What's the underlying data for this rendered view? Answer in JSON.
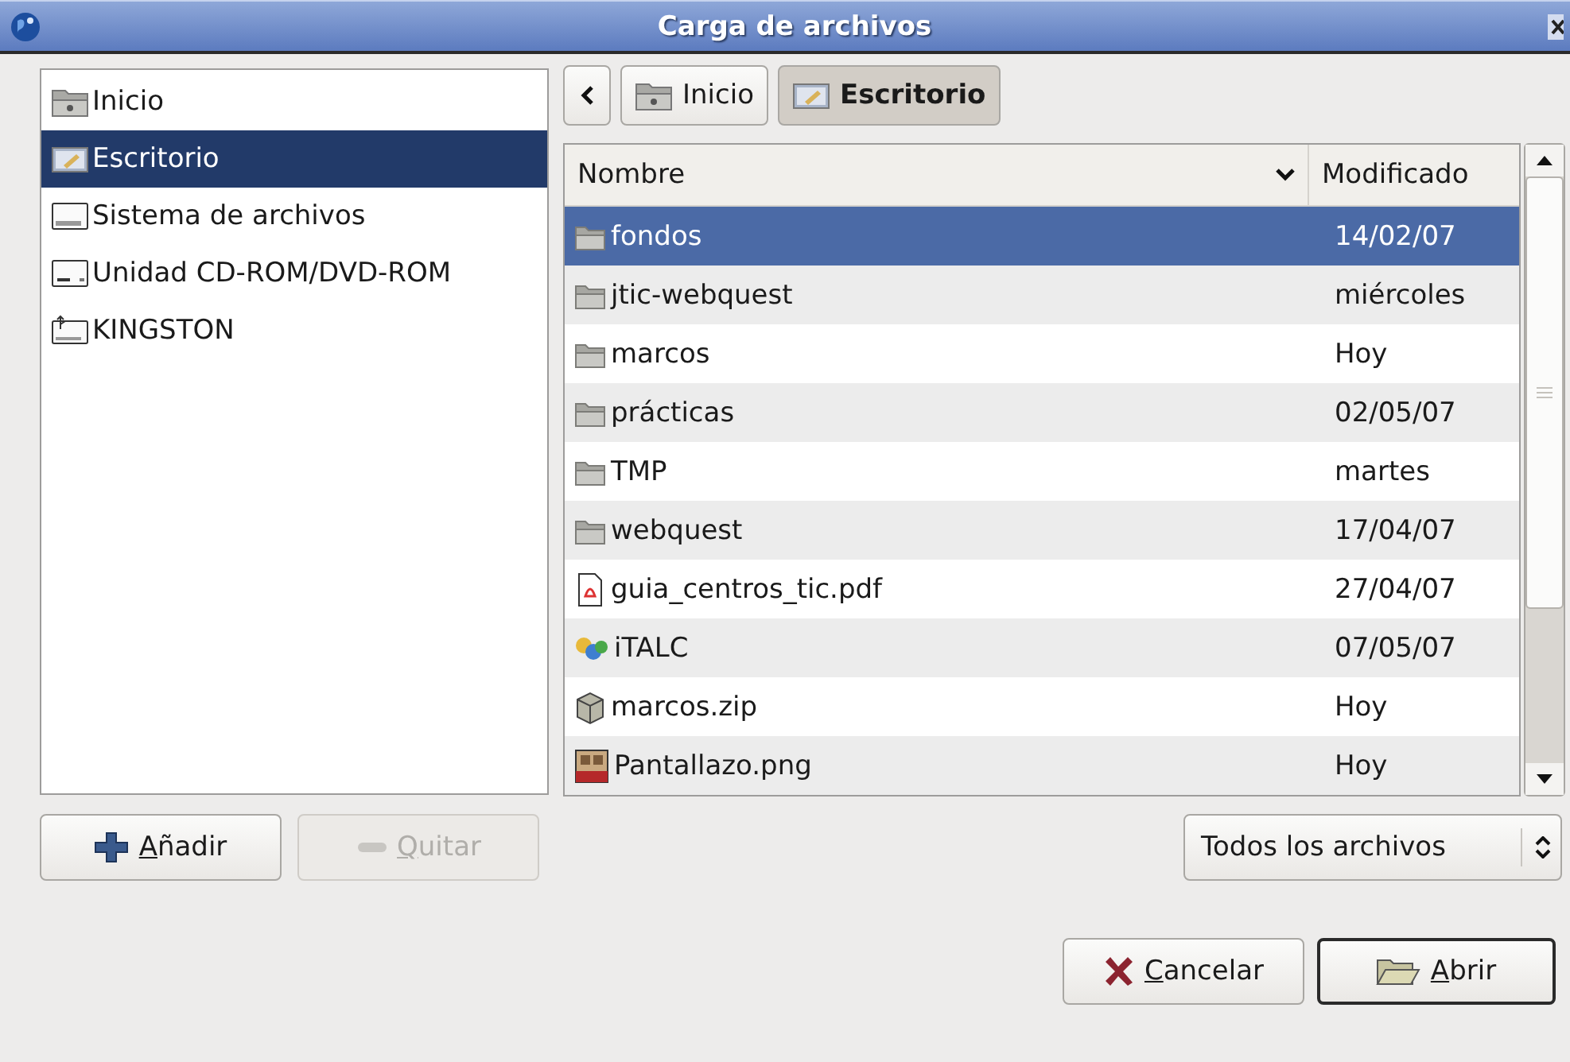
{
  "window": {
    "title": "Carga de archivos"
  },
  "places": [
    {
      "label": "Inicio",
      "kind": "home",
      "selected": false
    },
    {
      "label": "Escritorio",
      "kind": "desktop",
      "selected": true
    },
    {
      "label": "Sistema de archivos",
      "kind": "drive",
      "selected": false
    },
    {
      "label": "Unidad CD-ROM/DVD-ROM",
      "kind": "cdrom",
      "selected": false
    },
    {
      "label": "KINGSTON",
      "kind": "usb",
      "selected": false
    }
  ],
  "place_buttons": [
    {
      "mnemonic": "A",
      "rest": "ñadir",
      "kind": "add",
      "disabled": false
    },
    {
      "mnemonic": "Q",
      "rest": "uitar",
      "kind": "remove",
      "disabled": true
    }
  ],
  "path_bar": [
    {
      "label": "Inicio",
      "kind": "home",
      "selected": false
    },
    {
      "label": "Escritorio",
      "kind": "desktop",
      "selected": true
    }
  ],
  "table": {
    "columns": [
      "Nombre",
      "Modificado"
    ],
    "rows": [
      {
        "name": "fondos",
        "modified": "14/02/07",
        "kind": "folder",
        "selected": true
      },
      {
        "name": "jtic-webquest",
        "modified": "miércoles",
        "kind": "folder",
        "selected": false
      },
      {
        "name": "marcos",
        "modified": "Hoy",
        "kind": "folder",
        "selected": false
      },
      {
        "name": "prácticas",
        "modified": "02/05/07",
        "kind": "folder",
        "selected": false
      },
      {
        "name": "TMP",
        "modified": "martes",
        "kind": "folder",
        "selected": false
      },
      {
        "name": "webquest",
        "modified": "17/04/07",
        "kind": "folder",
        "selected": false
      },
      {
        "name": "guia_centros_tic.pdf",
        "modified": "27/04/07",
        "kind": "pdf",
        "selected": false
      },
      {
        "name": "iTALC",
        "modified": "07/05/07",
        "kind": "app",
        "selected": false
      },
      {
        "name": "marcos.zip",
        "modified": "Hoy",
        "kind": "archive",
        "selected": false
      },
      {
        "name": "Pantallazo.png",
        "modified": "Hoy",
        "kind": "image",
        "selected": false
      }
    ]
  },
  "filter": {
    "value": "Todos los archivos"
  },
  "actions": [
    {
      "mnemonic": "C",
      "rest": "ancelar",
      "kind": "cancel",
      "default": false
    },
    {
      "mnemonic": "A",
      "rest": "brir",
      "kind": "open",
      "default": true
    }
  ]
}
